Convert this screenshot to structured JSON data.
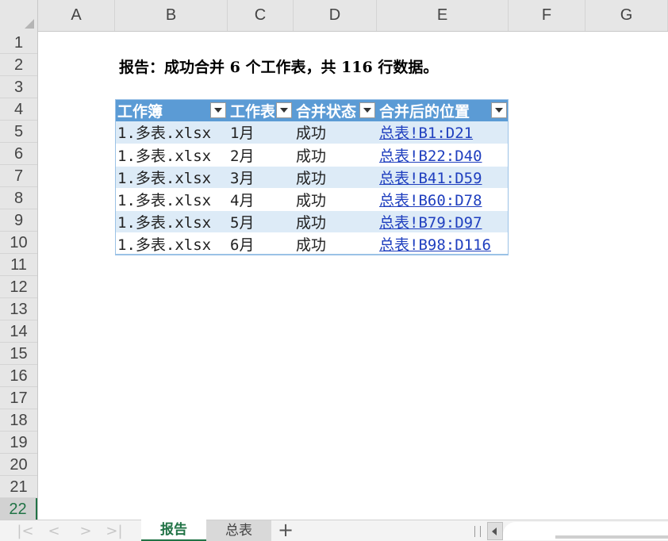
{
  "columns": [
    "A",
    "B",
    "C",
    "D",
    "E",
    "F",
    "G"
  ],
  "rows": [
    "1",
    "2",
    "3",
    "4",
    "5",
    "6",
    "7",
    "8",
    "9",
    "10",
    "11",
    "12",
    "13",
    "14",
    "15",
    "16",
    "17",
    "18",
    "19",
    "20",
    "21",
    "22"
  ],
  "selected_row": "22",
  "report": {
    "title": "报告：成功合并 6 个工作表，共 116 行数据。"
  },
  "table": {
    "headers": [
      "工作簿",
      "工作表",
      "合并状态",
      "合并后的位置"
    ],
    "rows": [
      [
        "1.多表.xlsx",
        "1月",
        "成功",
        "总表!B1:D21"
      ],
      [
        "1.多表.xlsx",
        "2月",
        "成功",
        "总表!B22:D40"
      ],
      [
        "1.多表.xlsx",
        "3月",
        "成功",
        "总表!B41:D59"
      ],
      [
        "1.多表.xlsx",
        "4月",
        "成功",
        "总表!B60:D78"
      ],
      [
        "1.多表.xlsx",
        "5月",
        "成功",
        "总表!B79:D97"
      ],
      [
        "1.多表.xlsx",
        "6月",
        "成功",
        "总表!B98:D116"
      ]
    ]
  },
  "tabs": {
    "nav": [
      "|<",
      "<",
      ">",
      ">|"
    ],
    "sheets": [
      {
        "label": "报告",
        "active": true
      },
      {
        "label": "总表",
        "active": false
      }
    ],
    "add": "+"
  },
  "colors": {
    "accent": "#217346",
    "table_header": "#5b9bd5",
    "table_band": "#ddebf7",
    "link": "#1f3fbf"
  }
}
